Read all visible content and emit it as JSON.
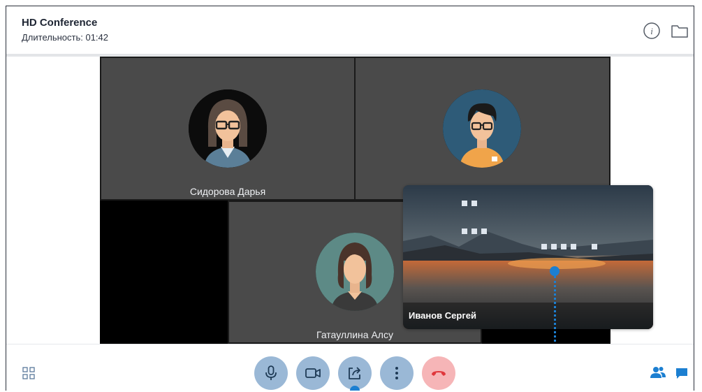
{
  "header": {
    "title": "HD Conference",
    "duration": "Длительность: 01:42",
    "info_icon": "info-icon",
    "folder_icon": "folder-icon"
  },
  "participants": [
    {
      "name": "Сидорова Дарья",
      "avatar": "woman-glasses-avatar"
    },
    {
      "name": "",
      "avatar": "man-glasses-avatar"
    },
    {
      "name": "Гатауллина Алсу",
      "avatar": "woman-avatar"
    }
  ],
  "screen_share": {
    "presenter": "Иванов Сергей"
  },
  "toolbar": {
    "buttons": [
      "microphone-icon",
      "camera-icon",
      "share-screen-icon",
      "more-icon",
      "end-call-icon"
    ],
    "layout_icon": "grid-layout-icon",
    "participants_icon": "participants-icon",
    "chat_icon": "chat-icon"
  },
  "colors": {
    "accent": "#1c7fd1",
    "control_button": "#9ab8d6",
    "end_call": "#f6b5b7",
    "end_call_icon": "#e0373c",
    "tile_bg": "#4a4a4a"
  }
}
